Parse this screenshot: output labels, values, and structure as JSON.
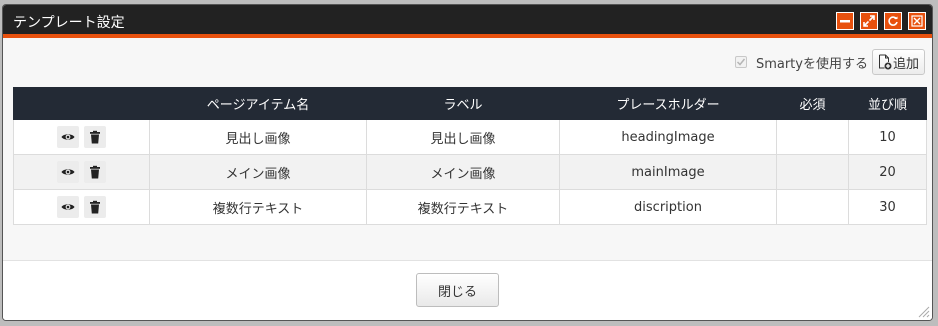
{
  "dialog": {
    "title": "テンプレート設定",
    "window_buttons": [
      "minimize-icon",
      "maximize-icon",
      "refresh-icon",
      "close-icon"
    ],
    "accent_color": "#e8510e"
  },
  "toolbar": {
    "smarty_label": "Smartyを使用する",
    "smarty_checked": true,
    "add_label": "追加"
  },
  "table": {
    "headers": [
      "",
      "ページアイテム名",
      "ラベル",
      "プレースホルダー",
      "必須",
      "並び順"
    ],
    "rows": [
      {
        "name": "見出し画像",
        "label": "見出し画像",
        "placeholder": "headingImage",
        "required": "",
        "order": "10"
      },
      {
        "name": "メイン画像",
        "label": "メイン画像",
        "placeholder": "mainImage",
        "required": "",
        "order": "20"
      },
      {
        "name": "複数行テキスト",
        "label": "複数行テキスト",
        "placeholder": "discription",
        "required": "",
        "order": "30"
      }
    ]
  },
  "footer": {
    "close_label": "閉じる"
  }
}
